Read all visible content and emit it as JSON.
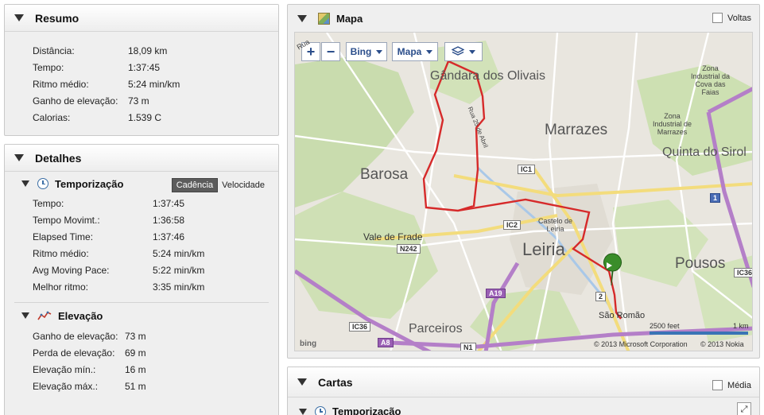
{
  "resumo": {
    "title": "Resumo",
    "rows": [
      {
        "label": "Distância:",
        "value": "18,09 km"
      },
      {
        "label": "Tempo:",
        "value": "1:37:45"
      },
      {
        "label": "Ritmo médio:",
        "value": "5:24 min/km"
      },
      {
        "label": "Ganho de elevação:",
        "value": "73 m"
      },
      {
        "label": "Calorias:",
        "value": "1.539 C"
      }
    ]
  },
  "detalhes": {
    "title": "Detalhes",
    "temporizacao": {
      "title": "Temporização",
      "toggle_on": "Cadência",
      "toggle_off": "Velocidade",
      "rows": [
        {
          "label": "Tempo:",
          "value": "1:37:45"
        },
        {
          "label": "Tempo Movimt.:",
          "value": "1:36:58"
        },
        {
          "label": "Elapsed Time:",
          "value": "1:37:46"
        },
        {
          "label": "Ritmo médio:",
          "value": "5:24 min/km"
        },
        {
          "label": "Avg Moving Pace:",
          "value": "5:22 min/km"
        },
        {
          "label": "Melhor ritmo:",
          "value": "3:35 min/km"
        }
      ]
    },
    "elevacao": {
      "title": "Elevação",
      "rows": [
        {
          "label": "Ganho de elevação:",
          "value": "73 m"
        },
        {
          "label": "Perda de elevação:",
          "value": "69 m"
        },
        {
          "label": "Elevação mín.:",
          "value": "16 m"
        },
        {
          "label": "Elevação máx.:",
          "value": "51 m"
        }
      ]
    }
  },
  "mapa": {
    "title": "Mapa",
    "voltas_label": "Voltas",
    "controls": {
      "zoom_in": "+",
      "zoom_out": "−",
      "provider": "Bing",
      "type": "Mapa"
    },
    "labels": {
      "gandara": "Gândara dos Olivais",
      "marrazes": "Marrazes",
      "barosa": "Barosa",
      "leiria": "Leiria",
      "castelo": "Castelo de\nLeiria",
      "vale_frade": "Vale de Frade",
      "parceiros": "Parceiros",
      "pousos": "Pousos",
      "quinta": "Quinta do Sirol",
      "zona_cova": "Zona\nIndustrial da\nCova das\nFaias",
      "zona_marrazes": "Zona\nIndustrial de\nMarrazes",
      "sao_romao": "São Romão",
      "rua25": "Rua 25 de Abril",
      "rua_top": "Rua"
    },
    "shields": {
      "ic1": "IC1",
      "ic2": "IC2",
      "n242": "N242",
      "a19": "A19",
      "ic36": "IC36",
      "ic36b": "IC36",
      "a8": "A8",
      "n1": "N1",
      "one": "1",
      "two": "2",
      "a8b": "A8"
    },
    "scale_ft": "2500 feet",
    "scale_km": "1 km",
    "copyright_ms": "© 2013 Microsoft Corporation",
    "copyright_nokia": "© 2013 Nokia",
    "bing_logo": "bing"
  },
  "cartas": {
    "title": "Cartas",
    "media_label": "Média",
    "sub_title": "Temporização"
  }
}
